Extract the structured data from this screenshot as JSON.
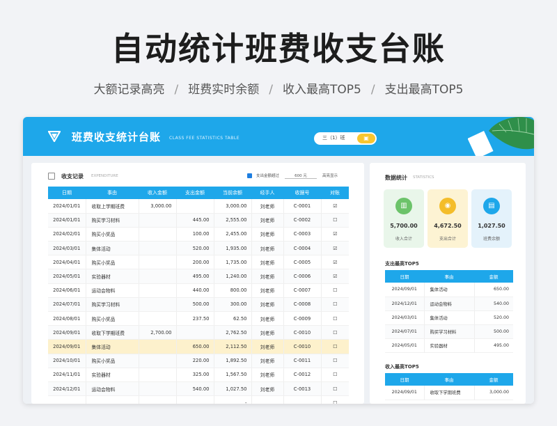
{
  "hero": {
    "title": "自动统计班费收支台账",
    "features": [
      "大额记录高亮",
      "班费实时余额",
      "收入最高TOP5",
      "支出最高TOP5"
    ],
    "separator": "/"
  },
  "app": {
    "title": "班费收支统计台账",
    "subtitle": "CLASS FEE STATISTICS TABLE",
    "class_selector": "三（1）班",
    "colors": {
      "accent": "#1ea7ea",
      "highlight": "#fdf1cc",
      "yellow": "#f8c630"
    }
  },
  "ledger": {
    "title": "收支记录",
    "title_en": "EXPENDITURE",
    "filter_label": "支出金额超过",
    "threshold": "600",
    "threshold_unit": "元",
    "filter_action": "高亮显示",
    "columns": [
      "日期",
      "事由",
      "收入金额",
      "支出金额",
      "当前余额",
      "经手人",
      "收据号",
      "对账"
    ],
    "rows": [
      {
        "date": "2024/01/01",
        "reason": "收取上学期班费",
        "income": "3,000.00",
        "expense": "",
        "balance": "3,000.00",
        "handler": "刘老师",
        "receipt": "C-0001",
        "check": "☑"
      },
      {
        "date": "2024/01/01",
        "reason": "购买学习材料",
        "income": "",
        "expense": "445.00",
        "balance": "2,555.00",
        "handler": "刘老师",
        "receipt": "C-0002",
        "check": "☐"
      },
      {
        "date": "2024/02/01",
        "reason": "购买小奖品",
        "income": "",
        "expense": "100.00",
        "balance": "2,455.00",
        "handler": "刘老师",
        "receipt": "C-0003",
        "check": "☑"
      },
      {
        "date": "2024/03/01",
        "reason": "集体活动",
        "income": "",
        "expense": "520.00",
        "balance": "1,935.00",
        "handler": "刘老师",
        "receipt": "C-0004",
        "check": "☑"
      },
      {
        "date": "2024/04/01",
        "reason": "购买小奖品",
        "income": "",
        "expense": "200.00",
        "balance": "1,735.00",
        "handler": "刘老师",
        "receipt": "C-0005",
        "check": "☑"
      },
      {
        "date": "2024/05/01",
        "reason": "实验器材",
        "income": "",
        "expense": "495.00",
        "balance": "1,240.00",
        "handler": "刘老师",
        "receipt": "C-0006",
        "check": "☑"
      },
      {
        "date": "2024/06/01",
        "reason": "运动会物料",
        "income": "",
        "expense": "440.00",
        "balance": "800.00",
        "handler": "刘老师",
        "receipt": "C-0007",
        "check": "☐"
      },
      {
        "date": "2024/07/01",
        "reason": "购买学习材料",
        "income": "",
        "expense": "500.00",
        "balance": "300.00",
        "handler": "刘老师",
        "receipt": "C-0008",
        "check": "☐"
      },
      {
        "date": "2024/08/01",
        "reason": "购买小奖品",
        "income": "",
        "expense": "237.50",
        "balance": "62.50",
        "handler": "刘老师",
        "receipt": "C-0009",
        "check": "☐"
      },
      {
        "date": "2024/09/01",
        "reason": "收取下学期班费",
        "income": "2,700.00",
        "expense": "",
        "balance": "2,762.50",
        "handler": "刘老师",
        "receipt": "C-0010",
        "check": "☐"
      },
      {
        "date": "2024/09/01",
        "reason": "集体活动",
        "income": "",
        "expense": "650.00",
        "balance": "2,112.50",
        "handler": "刘老师",
        "receipt": "C-0010",
        "check": "☐",
        "highlight": true
      },
      {
        "date": "2024/10/01",
        "reason": "购买小奖品",
        "income": "",
        "expense": "220.00",
        "balance": "1,892.50",
        "handler": "刘老师",
        "receipt": "C-0011",
        "check": "☐"
      },
      {
        "date": "2024/11/01",
        "reason": "实验器材",
        "income": "",
        "expense": "325.00",
        "balance": "1,567.50",
        "handler": "刘老师",
        "receipt": "C-0012",
        "check": "☐"
      },
      {
        "date": "2024/12/01",
        "reason": "运动会物料",
        "income": "",
        "expense": "540.00",
        "balance": "1,027.50",
        "handler": "刘老师",
        "receipt": "C-0013",
        "check": "☐"
      },
      {
        "date": "",
        "reason": "",
        "income": "",
        "expense": "",
        "balance": "-",
        "handler": "",
        "receipt": "",
        "check": "☐"
      }
    ]
  },
  "stats": {
    "title": "数据统计",
    "title_en": "STATISTICS",
    "cards": [
      {
        "value": "5,700.00",
        "label": "收入合计",
        "color": "#6cc36a",
        "bg": "#e9f6ea",
        "icon": "chart-icon"
      },
      {
        "value": "4,672.50",
        "label": "支出合计",
        "color": "#f4bd2a",
        "bg": "#fdf3d3",
        "icon": "coins-icon"
      },
      {
        "value": "1,027.50",
        "label": "班费余额",
        "color": "#1ea7ea",
        "bg": "#e4f2fb",
        "icon": "wallet-icon"
      }
    ]
  },
  "top_expense": {
    "title": "支出最高TOP5",
    "columns": [
      "日期",
      "事由",
      "金额"
    ],
    "rows": [
      {
        "date": "2024/09/01",
        "reason": "集体活动",
        "amount": "650.00"
      },
      {
        "date": "2024/12/01",
        "reason": "运动会物料",
        "amount": "540.00"
      },
      {
        "date": "2024/03/01",
        "reason": "集体活动",
        "amount": "520.00"
      },
      {
        "date": "2024/07/01",
        "reason": "购买学习材料",
        "amount": "500.00"
      },
      {
        "date": "2024/05/01",
        "reason": "实验器材",
        "amount": "495.00"
      }
    ]
  },
  "top_income": {
    "title": "收入最高TOP5",
    "columns": [
      "日期",
      "事由",
      "金额"
    ],
    "rows": [
      {
        "date": "2024/09/01",
        "reason": "收取下学期班费",
        "amount": "3,000.00"
      }
    ]
  }
}
